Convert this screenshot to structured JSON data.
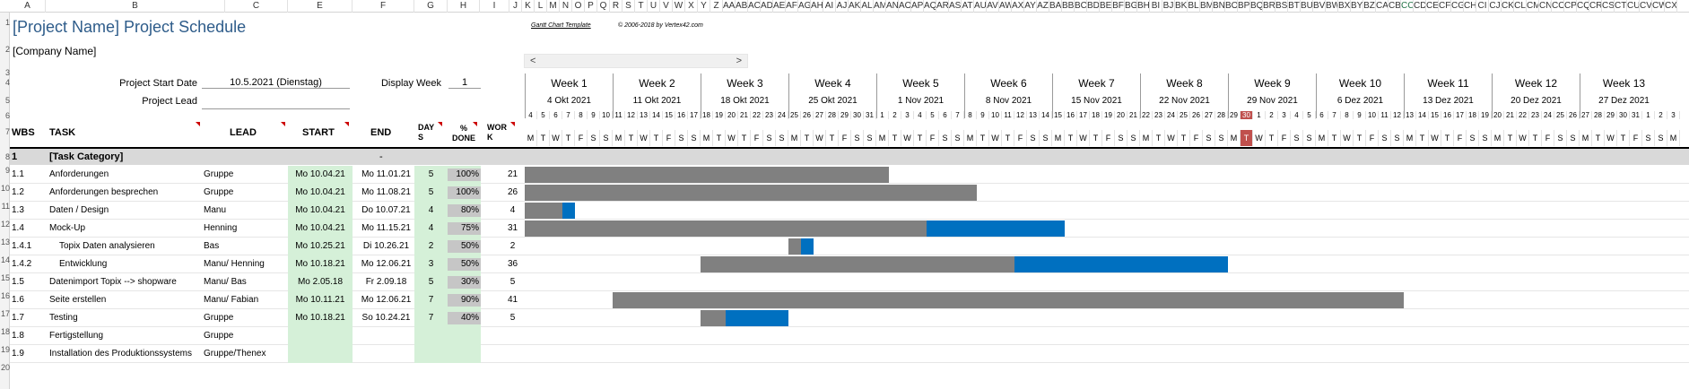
{
  "column_letters": [
    "A",
    "B",
    "C",
    "E",
    "F",
    "G",
    "H",
    "I",
    "J",
    "K",
    "L",
    "M",
    "N",
    "O",
    "P",
    "Q",
    "R",
    "S",
    "T",
    "U",
    "V",
    "W",
    "X",
    "Y",
    "Z",
    "AA",
    "AB",
    "AC",
    "AD",
    "AE",
    "AF",
    "AG",
    "AH",
    "AI",
    "AJ",
    "AK",
    "AL",
    "AM",
    "AN",
    "AO",
    "AP",
    "AQ",
    "AR",
    "AS",
    "AT",
    "AU",
    "AV",
    "AW",
    "AX",
    "AY",
    "AZ",
    "BA",
    "BB",
    "BC",
    "BD",
    "BE",
    "BF",
    "BG",
    "BH",
    "BI",
    "BJ",
    "BK",
    "BL",
    "BM",
    "BN",
    "BO",
    "BP",
    "BQ",
    "BR",
    "BS",
    "BT",
    "BU",
    "BV",
    "BW",
    "BX",
    "BY",
    "BZ",
    "CA",
    "CB",
    "CC",
    "CD",
    "CE",
    "CF",
    "CG",
    "CH",
    "CI",
    "CJ",
    "CK",
    "CL",
    "CM",
    "CN",
    "CO",
    "CP",
    "CQ",
    "CR",
    "CS",
    "CT",
    "CU",
    "CV",
    "CW",
    "CX"
  ],
  "selected_column": "CC",
  "row_numbers": [
    "1",
    "2",
    "3",
    "4",
    "5",
    "6",
    "7",
    "8",
    "9",
    "10",
    "11",
    "12",
    "13",
    "14",
    "15",
    "16",
    "17",
    "18",
    "19",
    "20"
  ],
  "header": {
    "title": "[Project Name] Project Schedule",
    "company": "[Company Name]",
    "template_link": "Gantt Chart Template",
    "copyright": "© 2006-2018 by Vertex42.com",
    "start_date_label": "Project Start Date",
    "start_date_value": "10.5.2021 (Dienstag)",
    "display_week_label": "Display Week",
    "display_week_value": "1",
    "lead_label": "Project Lead",
    "scroll_left": "<",
    "scroll_right": ">"
  },
  "columns": {
    "wbs": "WBS",
    "task": "TASK",
    "lead": "LEAD",
    "start": "START",
    "end": "END",
    "days": "DAYS",
    "pct": "% DONE",
    "work": "WORK"
  },
  "weeks": [
    {
      "label": "Week 1",
      "date": "4 Okt 2021"
    },
    {
      "label": "Week 2",
      "date": "11 Okt 2021"
    },
    {
      "label": "Week 3",
      "date": "18 Okt 2021"
    },
    {
      "label": "Week 4",
      "date": "25 Okt 2021"
    },
    {
      "label": "Week 5",
      "date": "1 Nov 2021"
    },
    {
      "label": "Week 6",
      "date": "8 Nov 2021"
    },
    {
      "label": "Week 7",
      "date": "15 Nov 2021"
    },
    {
      "label": "Week 8",
      "date": "22 Nov 2021"
    },
    {
      "label": "Week 9",
      "date": "29 Nov 2021"
    },
    {
      "label": "Week 10",
      "date": "6 Dez 2021"
    },
    {
      "label": "Week 11",
      "date": "13 Dez 2021"
    },
    {
      "label": "Week 12",
      "date": "20 Dez 2021"
    },
    {
      "label": "Week 13",
      "date": "27 Dez 2021"
    }
  ],
  "days": [
    "4",
    "5",
    "6",
    "7",
    "8",
    "9",
    "10",
    "11",
    "12",
    "13",
    "14",
    "15",
    "16",
    "17",
    "18",
    "19",
    "20",
    "21",
    "22",
    "23",
    "24",
    "25",
    "26",
    "27",
    "28",
    "29",
    "30",
    "31",
    "1",
    "2",
    "3",
    "4",
    "5",
    "6",
    "7",
    "8",
    "9",
    "10",
    "11",
    "12",
    "13",
    "14",
    "15",
    "16",
    "17",
    "18",
    "19",
    "20",
    "21",
    "22",
    "23",
    "24",
    "25",
    "26",
    "27",
    "28",
    "29",
    "30",
    "1",
    "2",
    "3",
    "4",
    "5",
    "6",
    "7",
    "8",
    "9",
    "10",
    "11",
    "12",
    "13",
    "14",
    "15",
    "16",
    "17",
    "18",
    "19",
    "20",
    "21",
    "22",
    "23",
    "24",
    "25",
    "26",
    "27",
    "28",
    "29",
    "30",
    "31",
    "1",
    "2",
    "3"
  ],
  "dow": [
    "M",
    "T",
    "W",
    "T",
    "F",
    "S",
    "S"
  ],
  "today_index": 57,
  "category": {
    "wbs": "1",
    "task": "[Task Category]",
    "end": "-"
  },
  "tasks": [
    {
      "wbs": "1.1",
      "task": "Anforderungen",
      "lead": "Gruppe",
      "start": "Mo 10.04.21",
      "end": "Mo 11.01.21",
      "days": "5",
      "pct": "100%",
      "pct_value": 1.0,
      "work": "21",
      "indent": false,
      "bar_start": 0,
      "gray_days": 29,
      "blue_days": 0
    },
    {
      "wbs": "1.2",
      "task": "Anforderungen besprechen",
      "lead": "Gruppe",
      "start": "Mo 10.04.21",
      "end": "Mo 11.08.21",
      "days": "5",
      "pct": "100%",
      "pct_value": 1.0,
      "work": "26",
      "indent": false,
      "bar_start": 0,
      "gray_days": 36,
      "blue_days": 0
    },
    {
      "wbs": "1.3",
      "task": "Daten / Design",
      "lead": "Manu",
      "start": "Mo 10.04.21",
      "end": "Do 10.07.21",
      "days": "4",
      "pct": "80%",
      "pct_value": 0.8,
      "work": "4",
      "indent": false,
      "bar_start": 0,
      "gray_days": 3,
      "blue_days": 1
    },
    {
      "wbs": "1.4",
      "task": "Mock-Up",
      "lead": "Henning",
      "start": "Mo 10.04.21",
      "end": "Mo 11.15.21",
      "days": "4",
      "pct": "75%",
      "pct_value": 0.75,
      "work": "31",
      "indent": false,
      "bar_start": 0,
      "gray_days": 32,
      "blue_days": 11
    },
    {
      "wbs": "1.4.1",
      "task": "Topix Daten analysieren",
      "lead": "Bas",
      "start": "Mo 10.25.21",
      "end": "Di 10.26.21",
      "days": "2",
      "pct": "50%",
      "pct_value": 0.5,
      "work": "2",
      "indent": true,
      "bar_start": 21,
      "gray_days": 1,
      "blue_days": 1
    },
    {
      "wbs": "1.4.2",
      "task": "Entwicklung",
      "lead": "Manu/ Henning",
      "start": "Mo 10.18.21",
      "end": "Mo 12.06.21",
      "days": "3",
      "pct": "50%",
      "pct_value": 0.5,
      "work": "36",
      "indent": true,
      "bar_start": 14,
      "gray_days": 25,
      "blue_days": 17
    },
    {
      "wbs": "1.5",
      "task": "Datenimport Topix --> shopware",
      "lead": "Manu/ Bas",
      "start": "Mo 2.05.18",
      "end": "Fr 2.09.18",
      "days": "5",
      "pct": "30%",
      "pct_value": 0.3,
      "work": "5",
      "indent": false,
      "bar_start": -1,
      "gray_days": 0,
      "blue_days": 0
    },
    {
      "wbs": "1.6",
      "task": "Seite erstellen",
      "lead": "Manu/ Fabian",
      "start": "Mo 10.11.21",
      "end": "Mo 12.06.21",
      "days": "7",
      "pct": "90%",
      "pct_value": 0.9,
      "work": "41",
      "indent": false,
      "bar_start": 7,
      "gray_days": 63,
      "blue_days": 0
    },
    {
      "wbs": "1.7",
      "task": "Testing",
      "lead": "Gruppe",
      "start": "Mo 10.18.21",
      "end": "So 10.24.21",
      "days": "7",
      "pct": "40%",
      "pct_value": 0.4,
      "work": "5",
      "indent": false,
      "bar_start": 14,
      "gray_days": 2,
      "blue_days": 5
    },
    {
      "wbs": "1.8",
      "task": "Fertigstellung",
      "lead": "Gruppe",
      "start": "",
      "end": "",
      "days": "",
      "pct": "",
      "pct_value": 0,
      "work": "",
      "indent": false,
      "bar_start": -1,
      "gray_days": 0,
      "blue_days": 0
    },
    {
      "wbs": "1.9",
      "task": "Installation des Produktionssystems",
      "lead": "Gruppe/Thenex",
      "start": "",
      "end": "",
      "days": "",
      "pct": "",
      "pct_value": 0,
      "work": "",
      "indent": false,
      "bar_start": -1,
      "gray_days": 0,
      "blue_days": 0
    }
  ],
  "colors": {
    "gray_bar": "#808080",
    "blue_bar": "#0070c0",
    "green_cell": "#d5f0d8",
    "today": "#c0504d",
    "title": "#2e5c8a"
  }
}
